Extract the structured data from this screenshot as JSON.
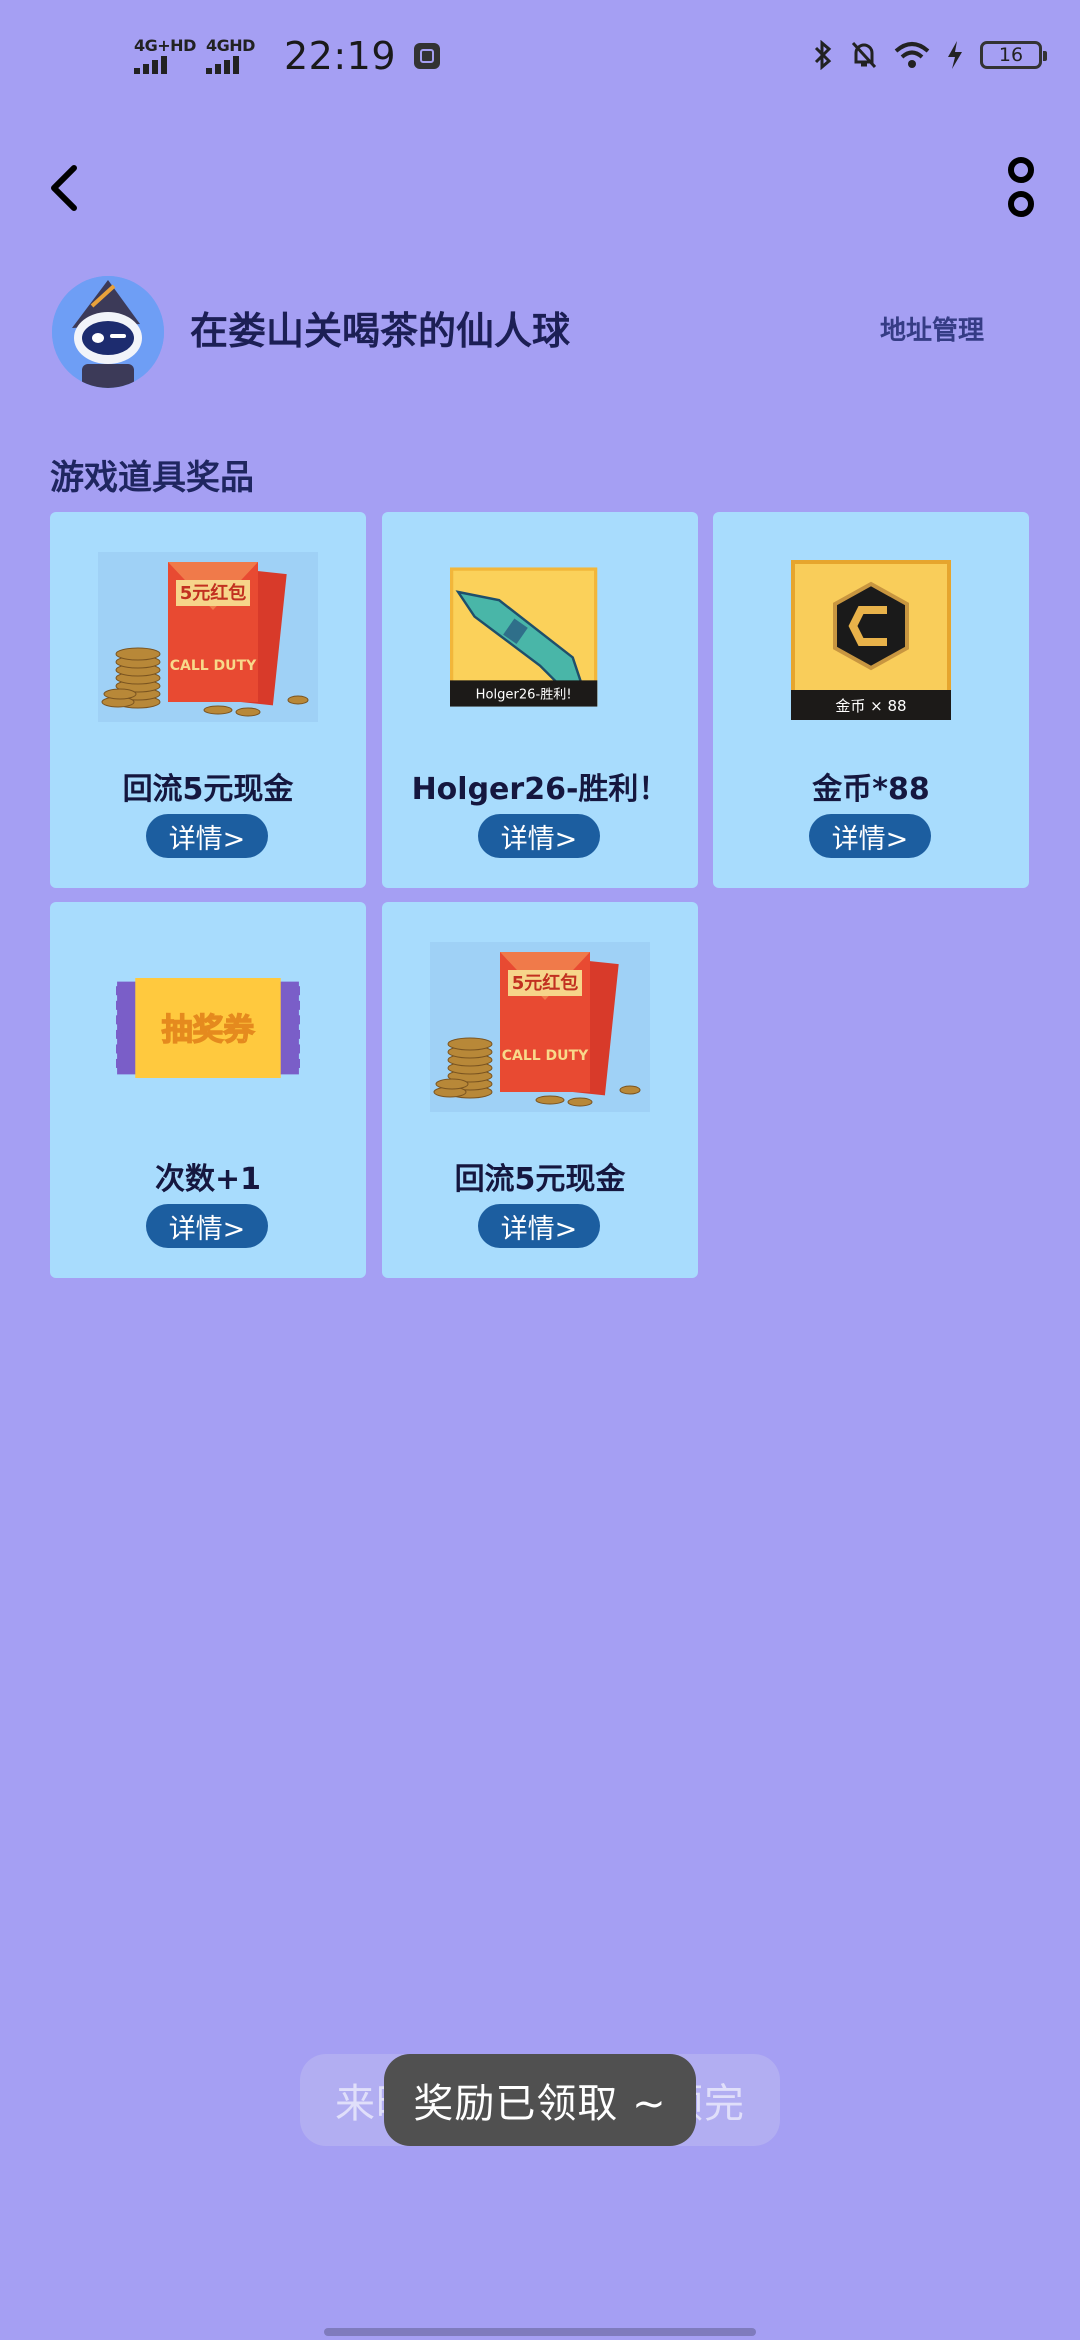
{
  "status_bar": {
    "signal_1_label": "4G+HD",
    "signal_2_label": "4GHD",
    "time": "22:19",
    "battery_level": "16"
  },
  "header": {
    "username": "在娄山关喝茶的仙人球",
    "address_link": "地址管理"
  },
  "section": {
    "title": "游戏道具奖品"
  },
  "prizes": [
    {
      "name": "回流5元现金",
      "detail_label": "详情>",
      "image": "red-envelope-5-yuan",
      "image_text": "5元红包",
      "image_brand": "CALL DUTY"
    },
    {
      "name": "Holger26-胜利！",
      "detail_label": "详情>",
      "image": "weapon-holger26",
      "image_caption": "Holger26-胜利!"
    },
    {
      "name": "金币*88",
      "detail_label": "详情>",
      "image": "gold-coin-88",
      "image_caption": "金币 × 88"
    },
    {
      "name": "次数+1",
      "detail_label": "详情>",
      "image": "lottery-ticket",
      "image_text": "抽奖券"
    },
    {
      "name": "回流5元现金",
      "detail_label": "详情>",
      "image": "red-envelope-5-yuan",
      "image_text": "5元红包",
      "image_brand": "CALL DUTY"
    }
  ],
  "toast": {
    "background_text": "来晚了，奖品已被领完",
    "message": "奖励已领取 ~"
  },
  "colors": {
    "background": "#a59ff3",
    "card": "#a8dcfd",
    "detail_button": "#1c5ea0",
    "toast": "#505050"
  }
}
